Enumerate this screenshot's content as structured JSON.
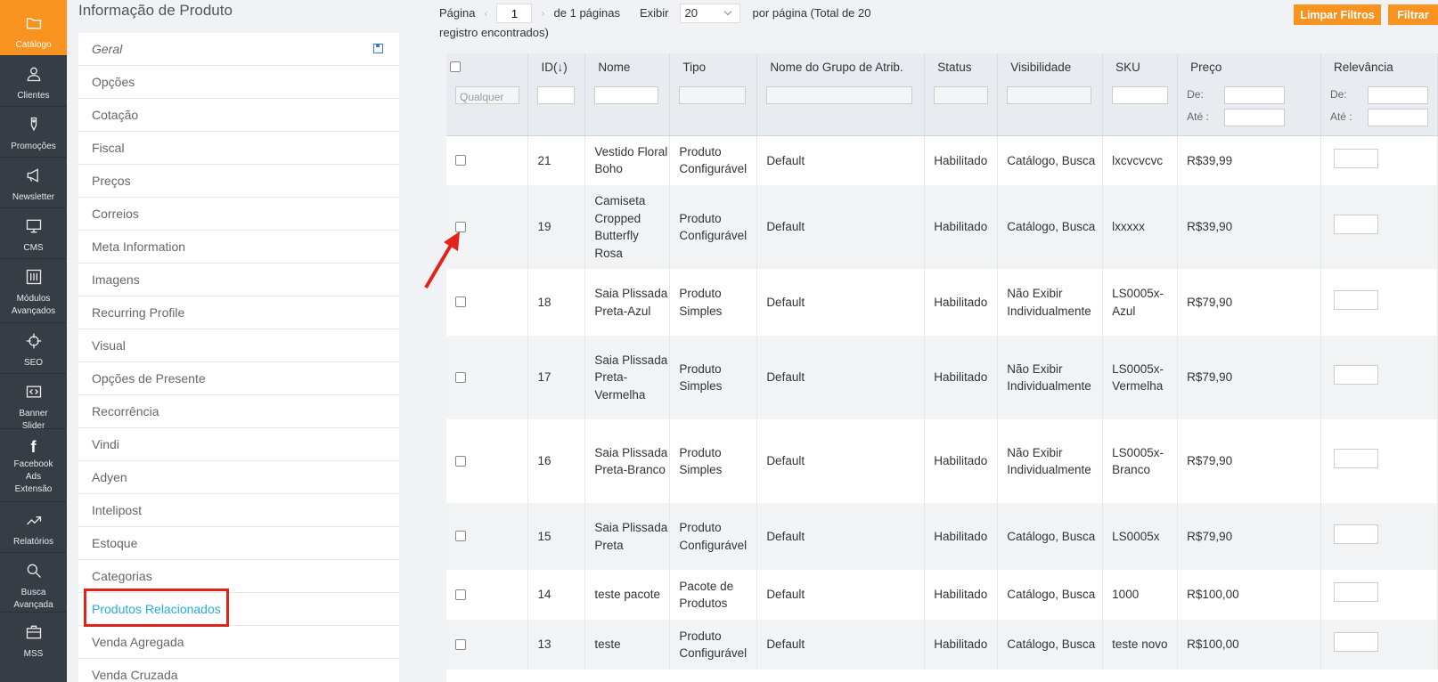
{
  "nav": [
    {
      "label": "Catálogo",
      "icon": "folder-icon",
      "active": true
    },
    {
      "label": "Clientes",
      "icon": "user-icon"
    },
    {
      "label": "Promoções",
      "icon": "tag-icon"
    },
    {
      "label": "Newsletter",
      "icon": "megaphone-icon"
    },
    {
      "label": "CMS",
      "icon": "monitor-icon"
    },
    {
      "label": "Módulos Avançados",
      "icon": "sliders-icon"
    },
    {
      "label": "SEO",
      "icon": "target-icon"
    },
    {
      "label": "Banner Slider",
      "icon": "code-icon"
    },
    {
      "label": "Facebook Ads Extensão",
      "icon": "facebook-icon"
    },
    {
      "label": "Relatórios",
      "icon": "chart-icon"
    },
    {
      "label": "Busca Avançada",
      "icon": "search-icon"
    },
    {
      "label": "MSS",
      "icon": "briefcase-icon"
    }
  ],
  "panel": {
    "title": "Informação de Produto",
    "tabs": [
      "Geral",
      "Opções",
      "Cotação",
      "Fiscal",
      "Preços",
      "Correios",
      "Meta Information",
      "Imagens",
      "Recurring Profile",
      "Visual",
      "Opções de Presente",
      "Recorrência",
      "Vindi",
      "Adyen",
      "Intelipost",
      "Estoque",
      "Categorias",
      "Produtos Relacionados",
      "Venda Agregada",
      "Venda Cruzada"
    ],
    "active_tab": "Produtos Relacionados"
  },
  "pager": {
    "page_label": "Página",
    "page_value": "1",
    "of_prefix": "de",
    "total_pages": "1",
    "of_suffix": "páginas",
    "show_label": "Exibir",
    "per_page": "20",
    "per_page_text": "por página (Total de",
    "total_records": "20",
    "records_suffix": "registro encontrados)"
  },
  "buttons": {
    "reset": "Limpar Filtros",
    "filter": "Filtrar"
  },
  "grid": {
    "headers": [
      "ID",
      "Nome",
      "Tipo",
      "Nome do Grupo de Atrib.",
      "Status",
      "Visibilidade",
      "SKU",
      "Preço",
      "Relevância"
    ],
    "sort_indicator": "(↓)",
    "filter": {
      "any": "Qualquer",
      "from": "De:",
      "to": "Até :"
    },
    "rows": [
      {
        "id": "21",
        "name": "Vestido Floral Boho",
        "type": "Produto Configurável",
        "attr_set": "Default",
        "status": "Habilitado",
        "visibility": "Catálogo, Busca",
        "sku": "lxcvcvcvc",
        "price": "R$39,99"
      },
      {
        "id": "19",
        "name": "Camiseta Cropped Butterfly Rosa",
        "type": "Produto Configurável",
        "attr_set": "Default",
        "status": "Habilitado",
        "visibility": "Catálogo, Busca",
        "sku": "lxxxxx",
        "price": "R$39,90"
      },
      {
        "id": "18",
        "name": "Saia Plissada Preta-Azul",
        "type": "Produto Simples",
        "attr_set": "Default",
        "status": "Habilitado",
        "visibility": "Não Exibir Individualmente",
        "sku": "LS0005x-Azul",
        "price": "R$79,90"
      },
      {
        "id": "17",
        "name": "Saia Plissada Preta-Vermelha",
        "type": "Produto Simples",
        "attr_set": "Default",
        "status": "Habilitado",
        "visibility": "Não Exibir Individualmente",
        "sku": "LS0005x-Vermelha",
        "price": "R$79,90"
      },
      {
        "id": "16",
        "name": "Saia Plissada Preta-Branco",
        "type": "Produto Simples",
        "attr_set": "Default",
        "status": "Habilitado",
        "visibility": "Não Exibir Individualmente",
        "sku": "LS0005x-Branco",
        "price": "R$79,90"
      },
      {
        "id": "15",
        "name": "Saia Plissada Preta",
        "type": "Produto Configurável",
        "attr_set": "Default",
        "status": "Habilitado",
        "visibility": "Catálogo, Busca",
        "sku": "LS0005x",
        "price": "R$79,90"
      },
      {
        "id": "14",
        "name": "teste pacote",
        "type": "Pacote de Produtos",
        "attr_set": "Default",
        "status": "Habilitado",
        "visibility": "Catálogo, Busca",
        "sku": "1000",
        "price": "R$100,00"
      },
      {
        "id": "13",
        "name": "teste",
        "type": "Produto Configurável",
        "attr_set": "Default",
        "status": "Habilitado",
        "visibility": "Catálogo, Busca",
        "sku": "teste novo",
        "price": "R$100,00"
      }
    ]
  },
  "colors": {
    "accent": "#f7931e",
    "nav_bg": "#373d45",
    "link": "#29a9e0",
    "highlight": "#e2231a"
  }
}
